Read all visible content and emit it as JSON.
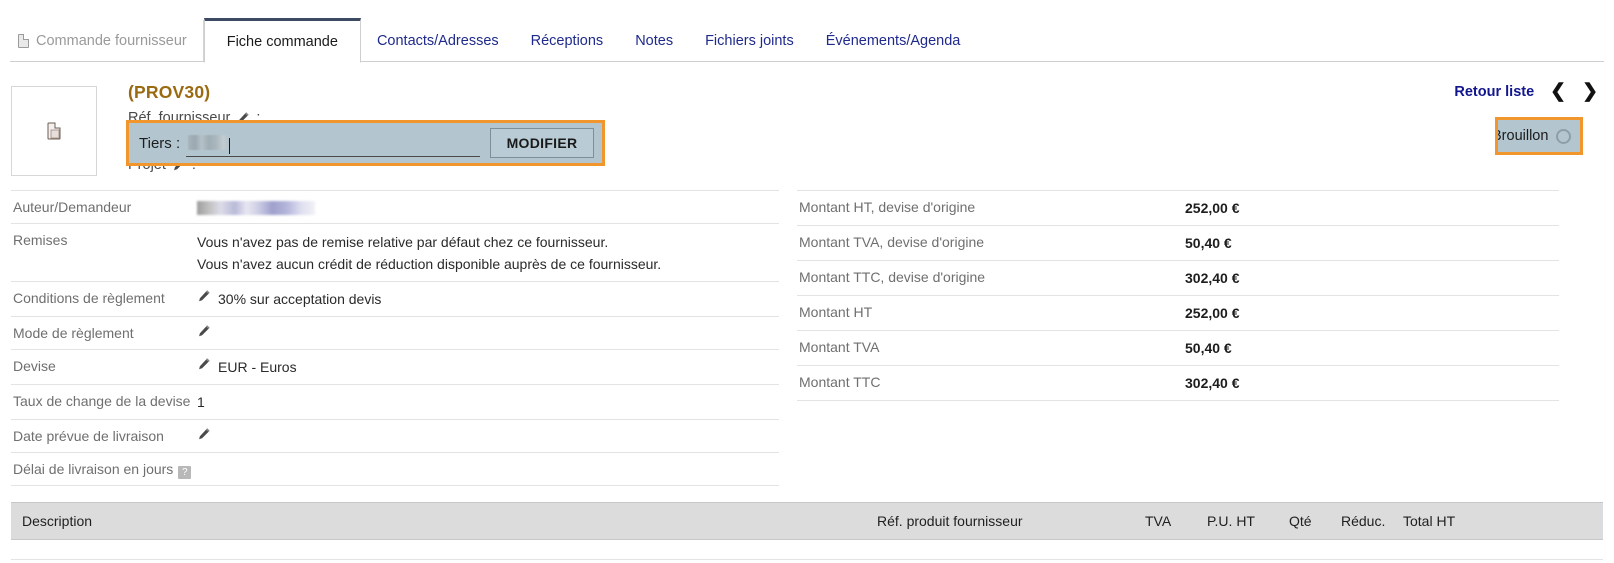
{
  "tabs": [
    {
      "label": "Commande fournisseur",
      "state": "muted",
      "icon": "document-icon"
    },
    {
      "label": "Fiche commande",
      "state": "active"
    },
    {
      "label": "Contacts/Adresses",
      "state": "link"
    },
    {
      "label": "Réceptions",
      "state": "link"
    },
    {
      "label": "Notes",
      "state": "link"
    },
    {
      "label": "Fichiers joints",
      "state": "link"
    },
    {
      "label": "Événements/Agenda",
      "state": "link"
    }
  ],
  "header": {
    "ref_title": "(PROV30)",
    "ref_fournisseur_label": "Réf. fournisseur",
    "ref_fournisseur_value": ":",
    "projet_label": "Projet",
    "projet_value": ":",
    "tiers_label": "Tiers :",
    "tiers_value": "",
    "modifier_button": "MODIFIER",
    "retour_liste": "Retour liste",
    "prev_arrow": "❮",
    "next_arrow": "❯",
    "status": "Brouillon",
    "highlight_color": "#f0962d",
    "overlay_bg": "#b3c6d0",
    "title_color": "#9a6a10"
  },
  "left_table": [
    {
      "label": "Auteur/Demandeur",
      "value": "",
      "redacted": true,
      "pencil": false
    },
    {
      "label": "Remises",
      "lines": [
        "Vous n'avez pas de remise relative par défaut chez ce fournisseur.",
        "Vous n'avez aucun crédit de réduction disponible auprès de ce fournisseur."
      ],
      "pencil": false
    },
    {
      "label": "Conditions de règlement",
      "value": "30% sur acceptation devis",
      "pencil": true
    },
    {
      "label": "Mode de règlement",
      "value": "",
      "pencil": true
    },
    {
      "label": "Devise",
      "value": "EUR - Euros",
      "pencil": true
    },
    {
      "label": "Taux de change de la devise",
      "value": "1",
      "pencil": false
    },
    {
      "label": "Date prévue de livraison",
      "value": "",
      "pencil": true
    },
    {
      "label": "Délai de livraison en jours",
      "value": "",
      "pencil": false,
      "help": true
    }
  ],
  "right_table": [
    {
      "label": "Montant HT, devise d'origine",
      "value": "252,00 €"
    },
    {
      "label": "Montant TVA, devise d'origine",
      "value": "50,40 €"
    },
    {
      "label": "Montant TTC, devise d'origine",
      "value": "302,40 €"
    },
    {
      "label": "Montant HT",
      "value": "252,00 €"
    },
    {
      "label": "Montant TVA",
      "value": "50,40 €"
    },
    {
      "label": "Montant TTC",
      "value": "302,40 €"
    }
  ],
  "lines_table": {
    "columns": {
      "description": "Description",
      "ref_produit": "Réf. produit fournisseur",
      "tva": "TVA",
      "pu_ht": "P.U. HT",
      "qte": "Qté",
      "reduc": "Réduc.",
      "total_ht": "Total HT"
    }
  }
}
